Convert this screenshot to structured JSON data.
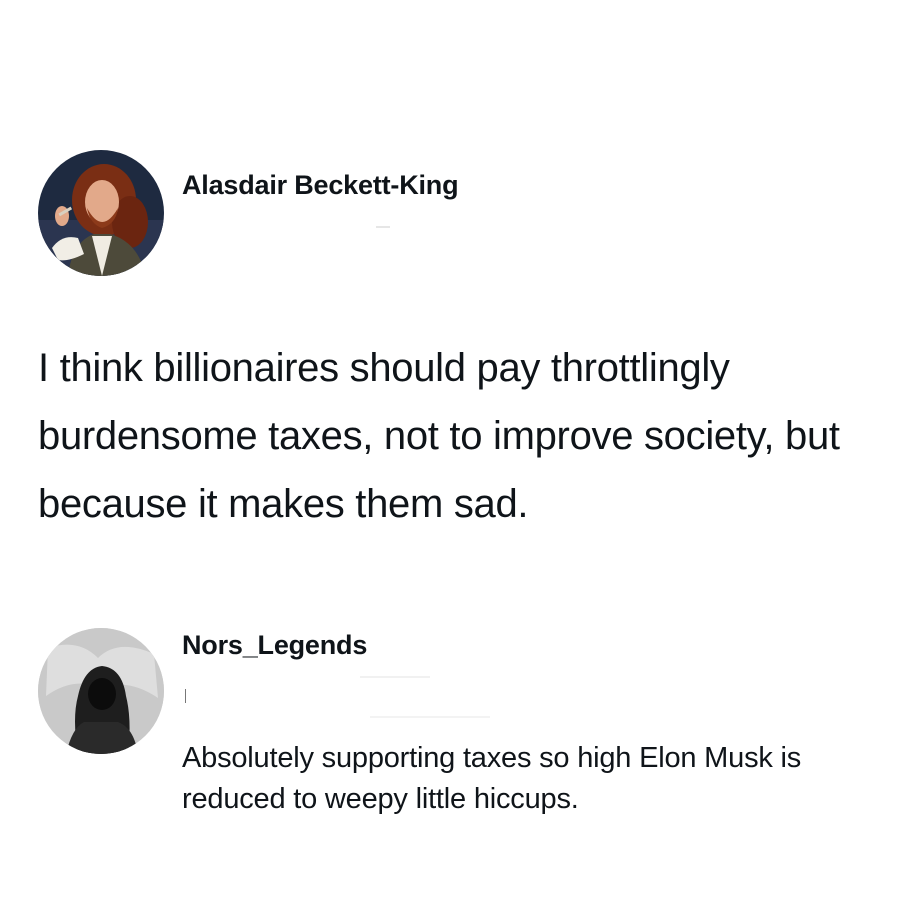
{
  "post": {
    "author": {
      "name": "Alasdair Beckett-King",
      "avatar_icon": "user-avatar-photo"
    },
    "text": "I think billionaires should pay throttlingly burdensome taxes, not to improve society, but because it makes them sad."
  },
  "reply": {
    "author": {
      "name": "Nors_Legends",
      "avatar_icon": "hooded-figure-avatar"
    },
    "text": "Absolutely supporting taxes so high Elon Musk is reduced to weepy little hiccups."
  }
}
